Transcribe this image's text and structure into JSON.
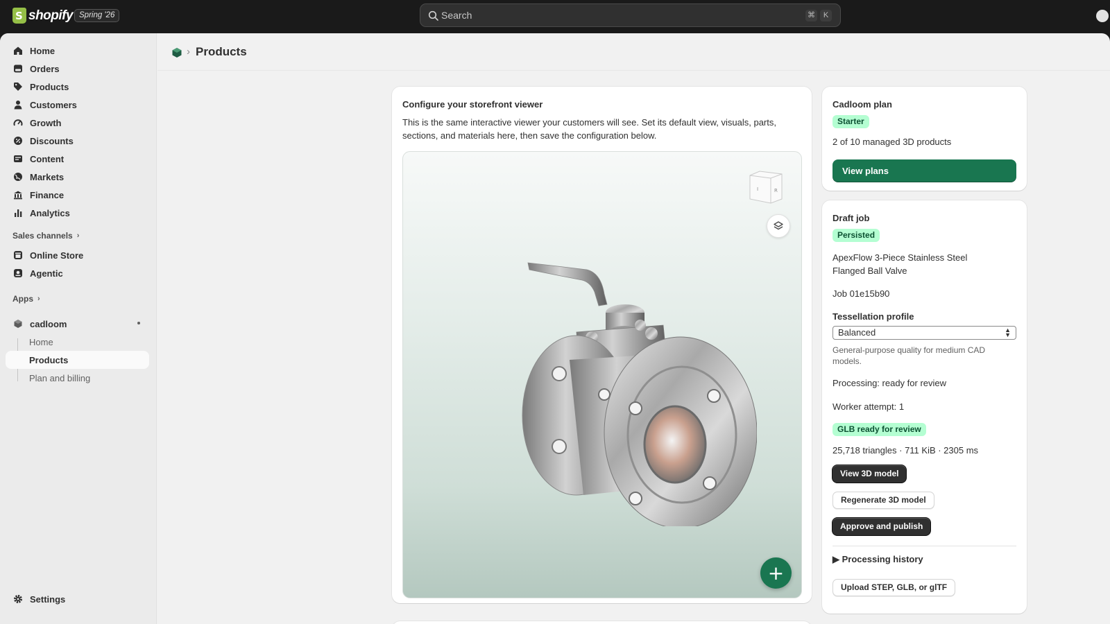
{
  "topbar": {
    "brand": "shopify",
    "version_badge": "Spring '26",
    "search_placeholder": "Search",
    "shortcut_cmd": "⌘",
    "shortcut_key": "K"
  },
  "sidebar": {
    "items": [
      {
        "label": "Home",
        "icon": "home-icon"
      },
      {
        "label": "Orders",
        "icon": "orders-icon"
      },
      {
        "label": "Products",
        "icon": "tag-icon"
      },
      {
        "label": "Customers",
        "icon": "person-icon"
      },
      {
        "label": "Growth",
        "icon": "gauge-icon"
      },
      {
        "label": "Discounts",
        "icon": "discount-icon"
      },
      {
        "label": "Content",
        "icon": "content-icon"
      },
      {
        "label": "Markets",
        "icon": "globe-icon"
      },
      {
        "label": "Finance",
        "icon": "bank-icon"
      },
      {
        "label": "Analytics",
        "icon": "bar-chart-icon"
      }
    ],
    "sales_channels_label": "Sales channels",
    "channels": [
      {
        "label": "Online Store",
        "icon": "store-icon"
      },
      {
        "label": "Agentic",
        "icon": "agent-icon"
      }
    ],
    "apps_label": "Apps",
    "app_name": "cadloom",
    "app_subitems": [
      "Home",
      "Products",
      "Plan and billing"
    ],
    "settings_label": "Settings"
  },
  "header": {
    "title": "Products"
  },
  "viewer": {
    "title": "Configure your storefront viewer",
    "description": "This is the same interactive viewer your customers will see. Set its default view, visuals, parts, sections, and materials here, then save the configuration below.",
    "cube_left": "I",
    "cube_right": "R",
    "fab_label": "+"
  },
  "plan": {
    "title": "Cadloom plan",
    "badge": "Starter",
    "usage": "2 of 10 managed 3D products",
    "view_plans": "View plans"
  },
  "job": {
    "title": "Draft job",
    "status_badge": "Persisted",
    "product_name": "ApexFlow 3-Piece Stainless Steel Flanged Ball Valve",
    "job_id": "Job 01e15b90",
    "tessellation_label": "Tessellation profile",
    "tessellation_value": "Balanced",
    "tessellation_help": "General-purpose quality for medium CAD models.",
    "processing": "Processing: ready for review",
    "worker_attempt": "Worker attempt: 1",
    "glb_badge": "GLB ready for review",
    "stats": "25,718 triangles · 711 KiB · 2305 ms",
    "view_model": "View 3D model",
    "regenerate": "Regenerate 3D model",
    "approve": "Approve and publish",
    "history": "▶ Processing history",
    "upload": "Upload STEP, GLB, or glTF"
  },
  "colors": {
    "accent_green": "#197650",
    "badge_green_bg": "#b4fed2",
    "topbar": "#1a1a1a"
  }
}
